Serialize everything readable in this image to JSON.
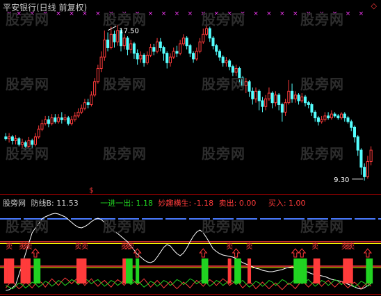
{
  "header": {
    "title": "平安银行(日线 前复权)",
    "diamond_icon": "◇"
  },
  "indicator": {
    "name": "股旁网",
    "line_b_label": "防线B: 11.53",
    "yijinyichu": "一进一出: 1.18",
    "miaoqu": "妙趣横生: -1.18",
    "sell": "卖出: 0.00",
    "buy": "买入: 1.00",
    "colors": {
      "name": "#c8c8c8",
      "yijinyichu": "#21d321",
      "miaoqu": "#ff3b3b",
      "sell": "#ff3b3b",
      "buy": "#ff3b3b"
    }
  },
  "watermark": "股旁网",
  "colors": {
    "up": "#ff3b3b",
    "down": "#54ffff",
    "magenta": "#ff3bff",
    "yellow": "#ffff00",
    "green": "#21d321",
    "white": "#ffffff",
    "blue": "#4a7bff",
    "divider": "#c00000"
  },
  "chart_data": {
    "type": "candlestick",
    "price_annotations": {
      "high": {
        "text": "17.50",
        "value": 17.5
      },
      "low": {
        "text": "9.30",
        "value": 9.3
      }
    },
    "sell_marker": "$",
    "sell_label": "卖",
    "buy_label": "买",
    "ylim": [
      9.0,
      18.0
    ],
    "candles": [
      [
        11.6,
        11.5,
        11.8,
        11.4
      ],
      [
        11.5,
        11.6,
        11.8,
        11.3
      ],
      [
        11.6,
        11.4,
        11.7,
        11.2
      ],
      [
        11.4,
        11.5,
        11.7,
        11.2
      ],
      [
        11.5,
        11.2,
        11.6,
        11.1
      ],
      [
        11.2,
        11.3,
        11.5,
        11.0
      ],
      [
        11.3,
        11.1,
        11.4,
        10.9
      ],
      [
        11.1,
        11.4,
        11.6,
        11.0
      ],
      [
        11.4,
        11.2,
        11.5,
        11.0
      ],
      [
        11.2,
        11.6,
        11.8,
        11.1
      ],
      [
        11.6,
        12.0,
        12.2,
        11.5
      ],
      [
        12.0,
        12.3,
        12.5,
        11.9
      ],
      [
        12.3,
        12.5,
        12.7,
        12.2
      ],
      [
        12.5,
        12.3,
        12.7,
        12.1
      ],
      [
        12.3,
        12.6,
        12.8,
        12.2
      ],
      [
        12.6,
        12.4,
        12.8,
        12.3
      ],
      [
        12.4,
        12.6,
        12.8,
        12.3
      ],
      [
        12.6,
        12.5,
        12.9,
        12.3
      ],
      [
        12.5,
        12.6,
        12.8,
        12.4
      ],
      [
        12.6,
        12.3,
        12.7,
        12.2
      ],
      [
        12.3,
        12.5,
        12.7,
        12.2
      ],
      [
        12.5,
        12.7,
        12.9,
        12.4
      ],
      [
        12.7,
        12.9,
        13.1,
        12.6
      ],
      [
        12.9,
        13.1,
        13.3,
        12.8
      ],
      [
        13.1,
        13.4,
        13.6,
        13.0
      ],
      [
        13.4,
        13.3,
        13.6,
        13.1
      ],
      [
        13.3,
        13.8,
        14.0,
        13.2
      ],
      [
        13.8,
        14.5,
        14.7,
        13.7
      ],
      [
        14.5,
        15.2,
        15.4,
        14.4
      ],
      [
        15.2,
        15.8,
        16.1,
        15.0
      ],
      [
        15.8,
        16.7,
        17.2,
        15.6
      ],
      [
        16.7,
        16.3,
        17.1,
        16.1
      ],
      [
        16.3,
        17.0,
        17.4,
        16.2
      ],
      [
        17.0,
        16.6,
        17.2,
        16.3
      ],
      [
        16.6,
        17.2,
        17.5,
        16.4
      ],
      [
        17.2,
        16.4,
        17.3,
        16.1
      ],
      [
        16.4,
        16.8,
        17.0,
        16.2
      ],
      [
        16.8,
        16.2,
        16.9,
        15.9
      ],
      [
        16.2,
        16.5,
        16.7,
        16.0
      ],
      [
        16.5,
        16.0,
        16.6,
        15.7
      ],
      [
        16.0,
        15.7,
        16.2,
        15.4
      ],
      [
        15.7,
        15.9,
        16.1,
        15.5
      ],
      [
        15.9,
        15.5,
        16.0,
        15.3
      ],
      [
        15.5,
        15.9,
        16.1,
        15.4
      ],
      [
        15.9,
        16.3,
        16.5,
        15.8
      ],
      [
        16.3,
        16.1,
        16.5,
        15.9
      ],
      [
        16.1,
        16.6,
        16.8,
        16.0
      ],
      [
        16.6,
        16.3,
        16.8,
        16.1
      ],
      [
        16.3,
        16.0,
        16.4,
        15.6
      ],
      [
        16.0,
        15.5,
        16.1,
        15.2
      ],
      [
        15.5,
        15.8,
        16.0,
        15.3
      ],
      [
        15.8,
        16.1,
        16.3,
        15.7
      ],
      [
        16.1,
        16.0,
        16.4,
        15.8
      ],
      [
        16.0,
        16.5,
        16.7,
        15.9
      ],
      [
        16.5,
        16.8,
        17.0,
        16.4
      ],
      [
        16.8,
        16.4,
        16.9,
        16.2
      ],
      [
        16.4,
        16.0,
        16.5,
        15.8
      ],
      [
        16.0,
        15.7,
        16.1,
        15.5
      ],
      [
        15.7,
        16.1,
        16.3,
        15.6
      ],
      [
        16.1,
        16.6,
        16.8,
        16.0
      ],
      [
        16.6,
        17.0,
        17.3,
        16.5
      ],
      [
        17.0,
        17.3,
        17.5,
        16.9
      ],
      [
        17.3,
        16.8,
        17.4,
        16.6
      ],
      [
        16.8,
        16.4,
        16.9,
        16.2
      ],
      [
        16.4,
        16.1,
        16.5,
        15.9
      ],
      [
        16.1,
        15.8,
        16.2,
        15.6
      ],
      [
        15.8,
        15.5,
        15.9,
        15.3
      ],
      [
        15.5,
        15.6,
        15.8,
        15.3
      ],
      [
        15.6,
        15.3,
        15.7,
        15.1
      ],
      [
        15.3,
        15.0,
        15.4,
        14.8
      ],
      [
        15.0,
        15.2,
        15.4,
        14.8
      ],
      [
        15.2,
        14.7,
        15.3,
        14.4
      ],
      [
        14.7,
        14.3,
        14.8,
        14.1
      ],
      [
        14.3,
        14.5,
        14.7,
        13.9
      ],
      [
        14.5,
        14.0,
        14.6,
        13.7
      ],
      [
        14.0,
        13.6,
        14.2,
        13.3
      ],
      [
        13.6,
        14.0,
        14.2,
        13.4
      ],
      [
        14.0,
        13.5,
        14.1,
        13.0
      ],
      [
        13.5,
        13.2,
        13.7,
        12.9
      ],
      [
        13.2,
        13.6,
        13.8,
        13.0
      ],
      [
        13.6,
        13.9,
        14.2,
        13.5
      ],
      [
        13.9,
        13.4,
        14.0,
        13.1
      ],
      [
        13.4,
        13.8,
        14.0,
        13.2
      ],
      [
        13.8,
        13.3,
        13.9,
        13.0
      ],
      [
        13.3,
        12.9,
        13.4,
        12.4
      ],
      [
        12.9,
        13.4,
        13.6,
        12.7
      ],
      [
        13.4,
        14.0,
        14.6,
        13.3
      ],
      [
        14.0,
        13.6,
        14.4,
        13.4
      ],
      [
        13.6,
        13.8,
        14.0,
        13.4
      ],
      [
        13.8,
        13.5,
        13.9,
        13.3
      ],
      [
        13.5,
        13.7,
        13.9,
        13.4
      ],
      [
        13.7,
        13.4,
        13.8,
        13.2
      ],
      [
        13.4,
        13.3,
        13.5,
        13.1
      ],
      [
        13.3,
        12.9,
        13.4,
        12.7
      ],
      [
        12.9,
        12.6,
        13.0,
        12.4
      ],
      [
        12.6,
        12.4,
        12.7,
        12.2
      ],
      [
        12.4,
        12.5,
        12.7,
        12.3
      ],
      [
        12.5,
        12.7,
        12.9,
        12.4
      ],
      [
        12.7,
        12.6,
        12.9,
        12.5
      ],
      [
        12.6,
        12.8,
        13.0,
        12.5
      ],
      [
        12.8,
        12.7,
        12.9,
        12.6
      ],
      [
        12.7,
        12.6,
        12.8,
        12.5
      ],
      [
        12.6,
        12.8,
        12.9,
        12.5
      ],
      [
        12.8,
        12.6,
        12.9,
        12.4
      ],
      [
        12.6,
        12.4,
        12.7,
        12.3
      ],
      [
        12.4,
        12.1,
        12.5,
        11.9
      ],
      [
        12.1,
        11.6,
        12.2,
        11.3
      ],
      [
        11.6,
        10.9,
        11.7,
        10.6
      ],
      [
        10.9,
        10.0,
        11.0,
        9.6
      ],
      [
        10.0,
        9.5,
        10.2,
        9.3
      ],
      [
        9.5,
        10.3,
        10.6,
        9.4
      ],
      [
        10.3,
        10.9,
        11.1,
        10.1
      ]
    ],
    "markers": {
      "top_cross_idx": [
        1,
        4,
        8,
        12,
        16,
        20,
        24,
        28,
        32,
        36,
        40,
        44,
        48,
        52,
        56,
        60,
        64,
        68,
        72,
        76,
        80,
        84,
        88,
        92,
        96,
        100,
        104,
        108
      ],
      "sell_idx": [
        1,
        5,
        6,
        7,
        22,
        24,
        36,
        37,
        38,
        68,
        74,
        94,
        103,
        104,
        105
      ],
      "buy_idx": [
        9,
        40,
        60,
        70,
        88,
        90,
        110
      ],
      "green_bars_idx": [
        9,
        10,
        37,
        38,
        40,
        60,
        61,
        70,
        71,
        88,
        89,
        90,
        91,
        110,
        111
      ],
      "red_bars_idx": [
        0,
        1,
        2,
        5,
        6,
        7,
        22,
        23,
        24,
        36,
        68,
        74,
        94,
        95,
        103,
        104,
        105
      ]
    },
    "indicator_white": [
      2,
      3,
      6,
      10,
      25,
      40,
      55,
      70,
      85,
      92,
      98,
      105,
      108,
      110,
      112,
      113,
      112,
      110,
      108,
      104,
      100,
      96,
      93,
      92,
      94,
      97,
      101,
      104,
      106,
      104,
      100,
      96,
      91,
      87,
      84,
      80,
      76,
      72,
      66,
      60,
      54,
      50,
      46,
      43,
      42,
      44,
      50,
      57,
      64,
      68,
      66,
      60,
      55,
      52,
      56,
      63,
      72,
      80,
      86,
      89,
      85,
      78,
      70,
      62,
      58,
      55,
      53,
      52,
      51,
      50,
      48,
      45,
      42,
      40,
      38,
      36,
      34,
      33,
      31,
      30,
      29,
      29,
      30,
      31,
      32,
      34,
      35,
      36,
      35,
      33,
      31,
      30,
      28,
      26,
      25,
      24,
      23,
      22,
      20,
      18,
      17,
      16,
      15,
      13,
      11,
      9,
      7,
      5,
      4,
      6,
      9,
      12
    ],
    "indicator_red": [
      3,
      8,
      12,
      6,
      2,
      5,
      10,
      7,
      3,
      8,
      12,
      9,
      4,
      9,
      14,
      10,
      6,
      11,
      15,
      12,
      8,
      12,
      16,
      11,
      6,
      10,
      14,
      9,
      5,
      9,
      12,
      8,
      4,
      9,
      13,
      10,
      6,
      11,
      15,
      11,
      7,
      10,
      14,
      9,
      4,
      8,
      12,
      8,
      3,
      7,
      11,
      6,
      2,
      6,
      10,
      7,
      3,
      8,
      12,
      9,
      5,
      9,
      13,
      10,
      6,
      10,
      14,
      11,
      6,
      9,
      12,
      8,
      3,
      7,
      11,
      7,
      2,
      6,
      10,
      6,
      2,
      6,
      9,
      5,
      1,
      5,
      9,
      6,
      2,
      7,
      11,
      8,
      4,
      8,
      12,
      9,
      5,
      9,
      12,
      8,
      4,
      8,
      11,
      7,
      3,
      7,
      10,
      6,
      2,
      6,
      9,
      5
    ],
    "indicator_green": [
      6,
      4,
      2,
      5,
      9,
      7,
      3,
      6,
      10,
      8,
      4,
      7,
      11,
      9,
      5,
      8,
      12,
      10,
      6,
      9,
      13,
      11,
      7,
      10,
      14,
      12,
      8,
      11,
      13,
      9,
      5,
      8,
      12,
      10,
      6,
      9,
      13,
      11,
      7,
      10,
      12,
      8,
      4,
      7,
      11,
      9,
      5,
      8,
      12,
      10,
      6,
      9,
      13,
      11,
      7,
      10,
      14,
      12,
      8,
      11,
      13,
      9,
      5,
      8,
      12,
      10,
      6,
      9,
      13,
      11,
      7,
      10,
      12,
      8,
      4,
      7,
      11,
      9,
      5,
      8,
      12,
      10,
      6,
      9,
      13,
      11,
      7,
      10,
      14,
      12,
      8,
      11,
      13,
      9,
      5,
      8,
      12,
      10,
      6,
      9,
      13,
      11,
      7,
      10,
      12,
      8,
      4,
      7,
      11,
      9,
      5,
      8
    ]
  }
}
